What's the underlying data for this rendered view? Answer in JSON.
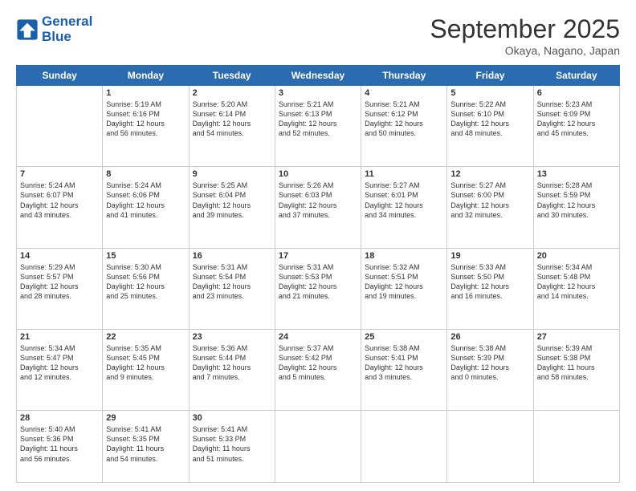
{
  "header": {
    "logo_general": "General",
    "logo_blue": "Blue",
    "month_title": "September 2025",
    "location": "Okaya, Nagano, Japan"
  },
  "days_of_week": [
    "Sunday",
    "Monday",
    "Tuesday",
    "Wednesday",
    "Thursday",
    "Friday",
    "Saturday"
  ],
  "weeks": [
    [
      {
        "day": "",
        "content": ""
      },
      {
        "day": "1",
        "content": "Sunrise: 5:19 AM\nSunset: 6:16 PM\nDaylight: 12 hours\nand 56 minutes."
      },
      {
        "day": "2",
        "content": "Sunrise: 5:20 AM\nSunset: 6:14 PM\nDaylight: 12 hours\nand 54 minutes."
      },
      {
        "day": "3",
        "content": "Sunrise: 5:21 AM\nSunset: 6:13 PM\nDaylight: 12 hours\nand 52 minutes."
      },
      {
        "day": "4",
        "content": "Sunrise: 5:21 AM\nSunset: 6:12 PM\nDaylight: 12 hours\nand 50 minutes."
      },
      {
        "day": "5",
        "content": "Sunrise: 5:22 AM\nSunset: 6:10 PM\nDaylight: 12 hours\nand 48 minutes."
      },
      {
        "day": "6",
        "content": "Sunrise: 5:23 AM\nSunset: 6:09 PM\nDaylight: 12 hours\nand 45 minutes."
      }
    ],
    [
      {
        "day": "7",
        "content": "Sunrise: 5:24 AM\nSunset: 6:07 PM\nDaylight: 12 hours\nand 43 minutes."
      },
      {
        "day": "8",
        "content": "Sunrise: 5:24 AM\nSunset: 6:06 PM\nDaylight: 12 hours\nand 41 minutes."
      },
      {
        "day": "9",
        "content": "Sunrise: 5:25 AM\nSunset: 6:04 PM\nDaylight: 12 hours\nand 39 minutes."
      },
      {
        "day": "10",
        "content": "Sunrise: 5:26 AM\nSunset: 6:03 PM\nDaylight: 12 hours\nand 37 minutes."
      },
      {
        "day": "11",
        "content": "Sunrise: 5:27 AM\nSunset: 6:01 PM\nDaylight: 12 hours\nand 34 minutes."
      },
      {
        "day": "12",
        "content": "Sunrise: 5:27 AM\nSunset: 6:00 PM\nDaylight: 12 hours\nand 32 minutes."
      },
      {
        "day": "13",
        "content": "Sunrise: 5:28 AM\nSunset: 5:59 PM\nDaylight: 12 hours\nand 30 minutes."
      }
    ],
    [
      {
        "day": "14",
        "content": "Sunrise: 5:29 AM\nSunset: 5:57 PM\nDaylight: 12 hours\nand 28 minutes."
      },
      {
        "day": "15",
        "content": "Sunrise: 5:30 AM\nSunset: 5:56 PM\nDaylight: 12 hours\nand 25 minutes."
      },
      {
        "day": "16",
        "content": "Sunrise: 5:31 AM\nSunset: 5:54 PM\nDaylight: 12 hours\nand 23 minutes."
      },
      {
        "day": "17",
        "content": "Sunrise: 5:31 AM\nSunset: 5:53 PM\nDaylight: 12 hours\nand 21 minutes."
      },
      {
        "day": "18",
        "content": "Sunrise: 5:32 AM\nSunset: 5:51 PM\nDaylight: 12 hours\nand 19 minutes."
      },
      {
        "day": "19",
        "content": "Sunrise: 5:33 AM\nSunset: 5:50 PM\nDaylight: 12 hours\nand 16 minutes."
      },
      {
        "day": "20",
        "content": "Sunrise: 5:34 AM\nSunset: 5:48 PM\nDaylight: 12 hours\nand 14 minutes."
      }
    ],
    [
      {
        "day": "21",
        "content": "Sunrise: 5:34 AM\nSunset: 5:47 PM\nDaylight: 12 hours\nand 12 minutes."
      },
      {
        "day": "22",
        "content": "Sunrise: 5:35 AM\nSunset: 5:45 PM\nDaylight: 12 hours\nand 9 minutes."
      },
      {
        "day": "23",
        "content": "Sunrise: 5:36 AM\nSunset: 5:44 PM\nDaylight: 12 hours\nand 7 minutes."
      },
      {
        "day": "24",
        "content": "Sunrise: 5:37 AM\nSunset: 5:42 PM\nDaylight: 12 hours\nand 5 minutes."
      },
      {
        "day": "25",
        "content": "Sunrise: 5:38 AM\nSunset: 5:41 PM\nDaylight: 12 hours\nand 3 minutes."
      },
      {
        "day": "26",
        "content": "Sunrise: 5:38 AM\nSunset: 5:39 PM\nDaylight: 12 hours\nand 0 minutes."
      },
      {
        "day": "27",
        "content": "Sunrise: 5:39 AM\nSunset: 5:38 PM\nDaylight: 11 hours\nand 58 minutes."
      }
    ],
    [
      {
        "day": "28",
        "content": "Sunrise: 5:40 AM\nSunset: 5:36 PM\nDaylight: 11 hours\nand 56 minutes."
      },
      {
        "day": "29",
        "content": "Sunrise: 5:41 AM\nSunset: 5:35 PM\nDaylight: 11 hours\nand 54 minutes."
      },
      {
        "day": "30",
        "content": "Sunrise: 5:41 AM\nSunset: 5:33 PM\nDaylight: 11 hours\nand 51 minutes."
      },
      {
        "day": "",
        "content": ""
      },
      {
        "day": "",
        "content": ""
      },
      {
        "day": "",
        "content": ""
      },
      {
        "day": "",
        "content": ""
      }
    ]
  ]
}
